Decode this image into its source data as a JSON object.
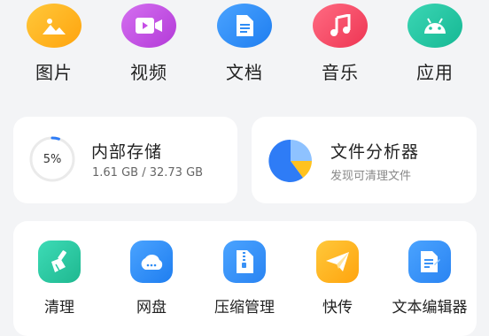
{
  "categories": [
    {
      "label": "图片",
      "icon": "image-icon",
      "color": "#ffb61a"
    },
    {
      "label": "视频",
      "icon": "video-icon",
      "color": "#c64ee6"
    },
    {
      "label": "文档",
      "icon": "document-icon",
      "color": "#2e8cf5"
    },
    {
      "label": "音乐",
      "icon": "music-icon",
      "color": "#f24a66"
    },
    {
      "label": "应用",
      "icon": "android-icon",
      "color": "#22c7a4"
    }
  ],
  "storage": {
    "title": "内部存储",
    "percent_label": "5%",
    "used_fraction": 0.05,
    "usage": "1.61 GB / 32.73 GB",
    "ring_color": "#2e7cf6"
  },
  "analyzer": {
    "title": "文件分析器",
    "subtitle": "发现可清理文件",
    "pie_colors": [
      "#2e7cf6",
      "#8ec2ff",
      "#ffc21f"
    ]
  },
  "tools": [
    {
      "label": "清理",
      "icon": "broom-icon",
      "color": "#29c9a3"
    },
    {
      "label": "网盘",
      "icon": "cloud-drive-icon",
      "color": "#2e8cf5"
    },
    {
      "label": "压缩管理",
      "icon": "zip-file-icon",
      "color": "#3a92f6"
    },
    {
      "label": "快传",
      "icon": "paper-plane-icon",
      "color": "#ffb61a"
    },
    {
      "label": "文本编辑器",
      "icon": "text-editor-icon",
      "color": "#3a92f6"
    }
  ]
}
